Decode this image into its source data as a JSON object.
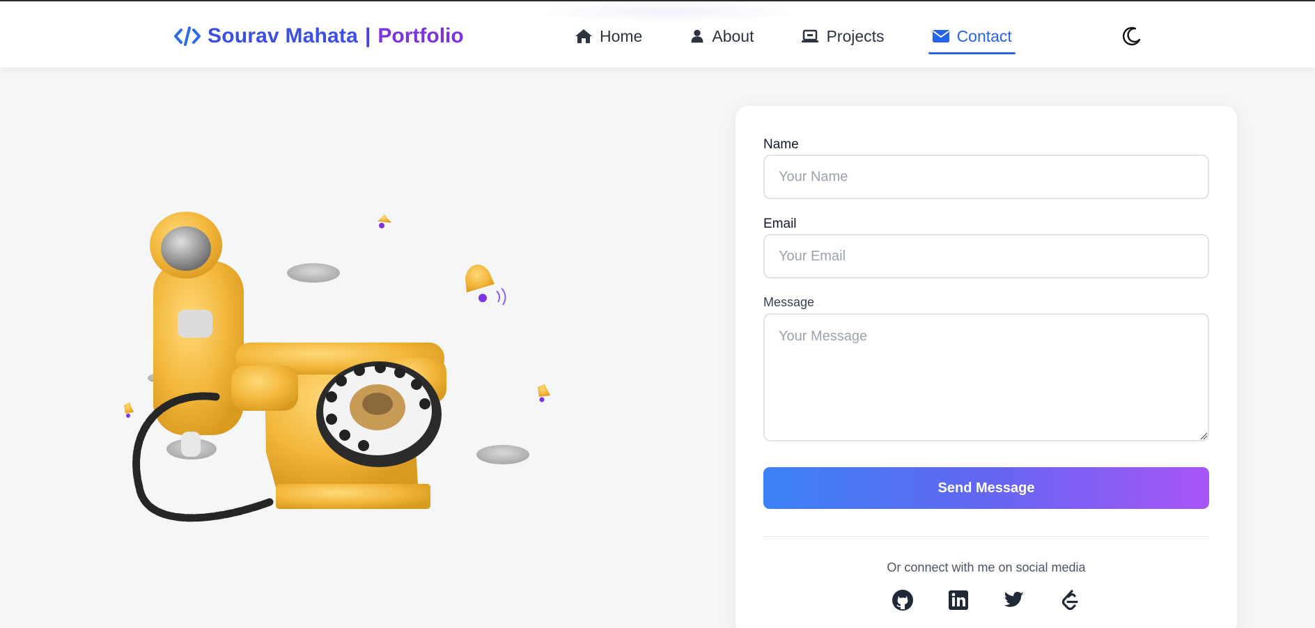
{
  "header": {
    "brand_name": "Sourav Mahata",
    "brand_separator": "|",
    "brand_suffix": "Portfolio",
    "brand_icon": "code-icon",
    "nav": [
      {
        "label": "Home",
        "icon": "home-icon",
        "active": false
      },
      {
        "label": "About",
        "icon": "user-icon",
        "active": false
      },
      {
        "label": "Projects",
        "icon": "laptop-icon",
        "active": false
      },
      {
        "label": "Contact",
        "icon": "envelope-icon",
        "active": true
      }
    ],
    "theme_toggle_icon": "moon-icon"
  },
  "contact_form": {
    "name_label": "Name",
    "name_placeholder": "Your Name",
    "email_label": "Email",
    "email_placeholder": "Your Email",
    "message_label": "Message",
    "message_placeholder": "Your Message",
    "submit_label": "Send Message",
    "social_text": "Or connect with me on social media",
    "socials": [
      "github-icon",
      "linkedin-icon",
      "twitter-icon",
      "leetcode-icon"
    ]
  },
  "colors": {
    "accent": "#2563eb",
    "brand_blue": "#3b4fe0",
    "brand_purple": "#7c34e0",
    "button_gradient_start": "#3b82f6",
    "button_gradient_end": "#a855f7",
    "page_background": "#f5f6f8"
  }
}
